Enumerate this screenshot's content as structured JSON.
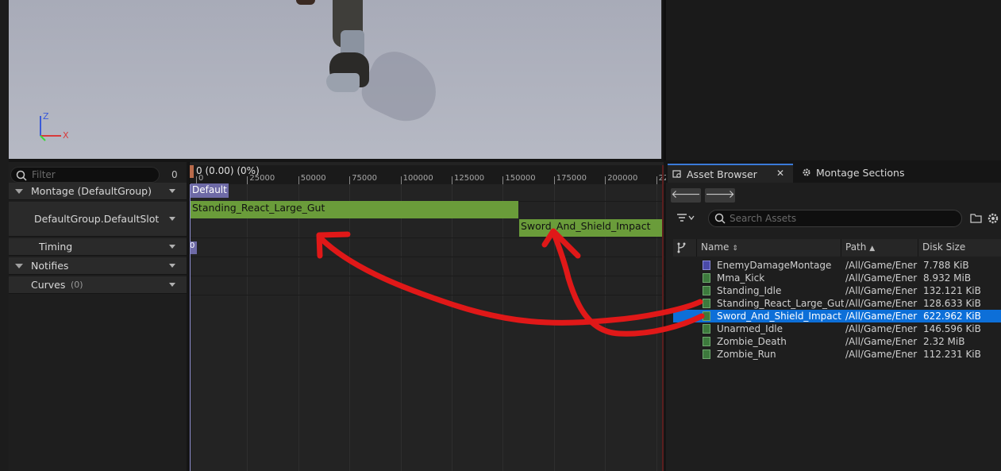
{
  "viewport": {
    "axis": {
      "z": "Z",
      "x": "X"
    }
  },
  "track_panel": {
    "filter_placeholder": "Filter",
    "filter_count": "0",
    "tracks": [
      {
        "label": "Montage (DefaultGroup)"
      },
      {
        "label": "DefaultGroup.DefaultSlot"
      },
      {
        "label": "Timing"
      },
      {
        "label": "Notifies"
      },
      {
        "label": "Curves",
        "count": "(0)"
      }
    ]
  },
  "timeline": {
    "current_time": "0 (0.00) (0%)",
    "ruler_labels": [
      "0",
      "25000",
      "50000",
      "75000",
      "100000",
      "125000",
      "150000",
      "175000",
      "200000",
      "22"
    ],
    "default_section": "Default",
    "segments": [
      {
        "label": "Standing_React_Large_Gut"
      },
      {
        "label": "Sword_And_Shield_Impact"
      }
    ],
    "timing_marker": "0"
  },
  "asset_browser": {
    "tabs": [
      {
        "label": "Asset Browser"
      },
      {
        "label": "Montage Sections"
      }
    ],
    "search_placeholder": "Search Assets",
    "columns": [
      "Name",
      "Path",
      "Disk Size"
    ],
    "rows": [
      {
        "name": "EnemyDamageMontage",
        "path": "/All/Game/Ener",
        "size": "7.788 KiB",
        "type": "montage",
        "selected": false
      },
      {
        "name": "Mma_Kick",
        "path": "/All/Game/Ener",
        "size": "8.932 MiB",
        "type": "anim",
        "selected": false
      },
      {
        "name": "Standing_Idle",
        "path": "/All/Game/Ener",
        "size": "132.121 KiB",
        "type": "anim",
        "selected": false
      },
      {
        "name": "Standing_React_Large_Gut",
        "path": "/All/Game/Ener",
        "size": "128.633 KiB",
        "type": "anim",
        "selected": false
      },
      {
        "name": "Sword_And_Shield_Impact",
        "path": "/All/Game/Ener",
        "size": "622.962 KiB",
        "type": "anim",
        "selected": true
      },
      {
        "name": "Unarmed_Idle",
        "path": "/All/Game/Ener",
        "size": "146.596 KiB",
        "type": "anim",
        "selected": false
      },
      {
        "name": "Zombie_Death",
        "path": "/All/Game/Ener",
        "size": "2.32 MiB",
        "type": "anim",
        "selected": false
      },
      {
        "name": "Zombie_Run",
        "path": "/All/Game/Ener",
        "size": "112.231 KiB",
        "type": "anim",
        "selected": false
      }
    ]
  },
  "colors": {
    "segment": "#6a9c3a",
    "selection": "#0d6fd8",
    "annotation": "#e01818"
  }
}
